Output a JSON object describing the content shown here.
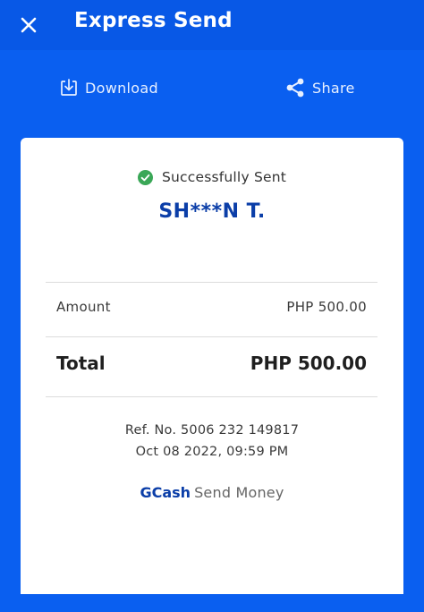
{
  "header": {
    "title": "Express Send",
    "close_icon": "close-icon"
  },
  "actions": {
    "download_label": "Download",
    "download_icon": "download-icon",
    "share_label": "Share",
    "share_icon": "share-icon"
  },
  "receipt": {
    "status_label": "Successfully Sent",
    "status_icon": "check-circle-icon",
    "recipient_name": "SH***N T.",
    "amount_label": "Amount",
    "amount_value": "PHP 500.00",
    "total_label": "Total",
    "total_value": "PHP 500.00",
    "ref_no": "Ref. No. 5006 232 149817",
    "datetime": "Oct 08 2022, 09:59 PM",
    "brand_name": "GCash",
    "brand_suffix": "Send Money"
  },
  "colors": {
    "background": "#0a5ff0",
    "header": "#0858e6",
    "recipient": "#0b3ea8",
    "success": "#3aa757"
  }
}
